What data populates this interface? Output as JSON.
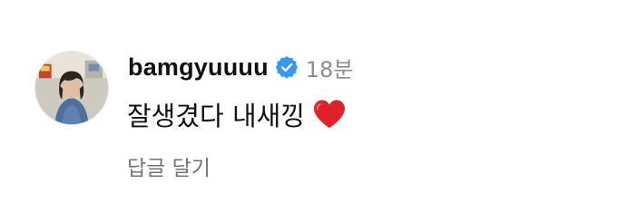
{
  "comment": {
    "username": "bamgyuuuu",
    "verified_icon": "verified-badge-icon",
    "timestamp": "18분",
    "message": "잘생겼다 내새낑",
    "emoji_icon": "red-heart-icon",
    "reply_label": "답글 달기"
  },
  "colors": {
    "verified_blue": "#3897f0",
    "heart_red": "#e0202a",
    "muted_text": "#8e8e8e",
    "reply_text": "#737373"
  }
}
